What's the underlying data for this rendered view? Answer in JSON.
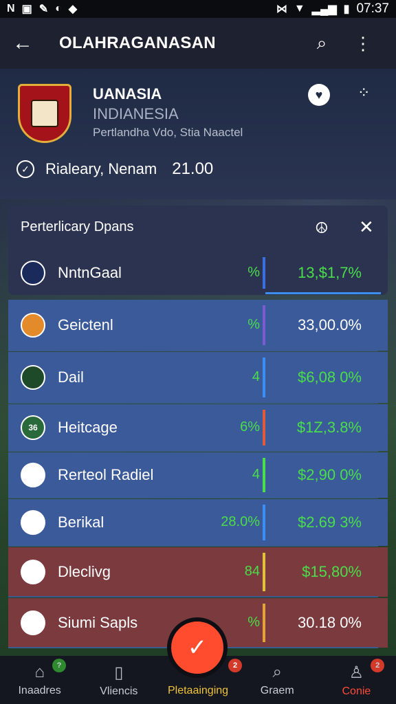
{
  "status_bar": {
    "time": "07:37",
    "left_icons": [
      "n-icon",
      "image-icon",
      "edit-icon",
      "whatsapp-icon",
      "dot-icon"
    ],
    "right_icons": [
      "no-signal-icon",
      "wifi-icon",
      "signal-icon",
      "battery-icon"
    ]
  },
  "appbar": {
    "title": "OLAHRAGANASAN"
  },
  "team": {
    "name": "UANASIA",
    "subtitle": "INDIANESIA",
    "description": "Pertlandha Vdo, Stia Naactel"
  },
  "match": {
    "label": "Rialeary, Nenam",
    "time": "21.00"
  },
  "panel": {
    "title": "Perterlicary Dpans"
  },
  "colors": {
    "green": "#4ade4a",
    "accent": "#ff4b2e",
    "active_nav": "#f0c33a",
    "alert_nav": "#ff4a3a"
  },
  "rows": [
    {
      "name": "NntnGaal",
      "pct": "%",
      "value": "13,$1,7%",
      "bar_color": "#3a6fe0",
      "value_color": "green",
      "logo_bg": "#1a2a5a",
      "logo_text": "",
      "row_bg": "transparent"
    },
    {
      "name": "Geictenl",
      "pct": "%",
      "value": "33,00.0%",
      "bar_color": "#7a5bd0",
      "value_color": "white",
      "logo_bg": "#e38a2a",
      "logo_text": "",
      "row_bg": "#3b5a9a"
    },
    {
      "name": "Dail",
      "pct": "4",
      "value": "$6,08 0%",
      "bar_color": "#3a8ff0",
      "value_color": "green",
      "logo_bg": "#1e4a2a",
      "logo_text": "",
      "row_bg": "#3b5a9a"
    },
    {
      "name": "Heitcage",
      "pct": "6%",
      "value": "$1Z,3.8%",
      "bar_color": "#e35a3a",
      "value_color": "green",
      "logo_bg": "#2a6a3a",
      "logo_text": "36",
      "row_bg": "#3b5a9a"
    },
    {
      "name": "Rerteol Radiel",
      "pct": "4",
      "value": "$2,90 0%",
      "bar_color": "#4ade4a",
      "value_color": "green",
      "logo_bg": "#ffffff",
      "logo_text": "",
      "row_bg": "#3b5a9a"
    },
    {
      "name": "Berikal",
      "pct": "28.0%",
      "value": "$2.69 3%",
      "bar_color": "#3a8ff0",
      "value_color": "green",
      "logo_bg": "#ffffff",
      "logo_text": "",
      "row_bg": "#3b5a9a"
    },
    {
      "name": "Dleclivg",
      "pct": "84",
      "value": "$15,80%",
      "bar_color": "#e3c03a",
      "value_color": "green",
      "logo_bg": "#ffffff",
      "logo_text": "",
      "row_bg": "#7a3a3e"
    },
    {
      "name": "Siumi Sapls",
      "pct": "%",
      "value": "30.18 0%",
      "bar_color": "#e3a33a",
      "value_color": "white",
      "logo_bg": "#ffffff",
      "logo_text": "",
      "row_bg": "#7a3a3e"
    }
  ],
  "nav": [
    {
      "label": "Inaadres",
      "icon": "home-icon",
      "badge": "?",
      "badge_color": "#2f8a2f"
    },
    {
      "label": "Vliencis",
      "icon": "clipboard-icon",
      "badge": "",
      "badge_color": ""
    },
    {
      "label": "Pletaainging",
      "icon": "",
      "badge": "",
      "badge_color": ""
    },
    {
      "label": "Graem",
      "icon": "search-icon",
      "badge": "",
      "badge_color": ""
    },
    {
      "label": "Conie",
      "icon": "profile-icon",
      "badge": "2",
      "badge_color": "#d43a2a"
    }
  ],
  "fab_badge": "2"
}
